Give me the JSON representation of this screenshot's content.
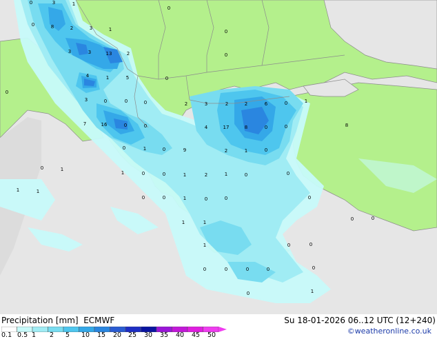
{
  "header": {
    "title": "Precipitation [mm]",
    "model": "ECMWF",
    "valid_time": "Su 18-01-2026 06..12 UTC (12+240)",
    "credit": "©weatheronline.co.uk"
  },
  "legend": {
    "ticks": [
      "0.1",
      "0.5",
      "1",
      "2",
      "5",
      "10",
      "15",
      "20",
      "25",
      "30",
      "35",
      "40",
      "45",
      "50"
    ],
    "colors": [
      "#ffffff",
      "#c8fafa",
      "#a0ecf4",
      "#78dcf0",
      "#4ec6ee",
      "#34a8e8",
      "#2a86e0",
      "#2a5cd2",
      "#1e2ec4",
      "#0a14a0",
      "#9a16d8",
      "#c218d8",
      "#e01ee0",
      "#f03cf0"
    ]
  },
  "colors": {
    "land_green": "#b4f08c",
    "background_grey": "#dcdcdc",
    "sea_grey": "#e6e6e6",
    "border": "#8c8c8c"
  },
  "map_labels": [
    "0",
    "3",
    "1",
    "0",
    "8",
    "2",
    "3",
    "1",
    "0",
    "3",
    "3",
    "13",
    "2",
    "0",
    "0",
    "4",
    "1",
    "5",
    "0",
    "0",
    "3",
    "0",
    "0",
    "0",
    "2",
    "3",
    "2",
    "2",
    "6",
    "0",
    "1",
    "7",
    "16",
    "0",
    "0",
    "4",
    "17",
    "8",
    "0",
    "0",
    "8",
    "0",
    "1",
    "0",
    "9",
    "2",
    "1",
    "0",
    "0",
    "1",
    "1",
    "0",
    "0",
    "1",
    "2",
    "1",
    "0",
    "0",
    "1",
    "1",
    "0",
    "0",
    "1",
    "0",
    "0",
    "0",
    "1",
    "1",
    "0",
    "0",
    "1",
    "0",
    "0",
    "0",
    "0",
    "0",
    "0",
    "0",
    "1",
    "0"
  ]
}
